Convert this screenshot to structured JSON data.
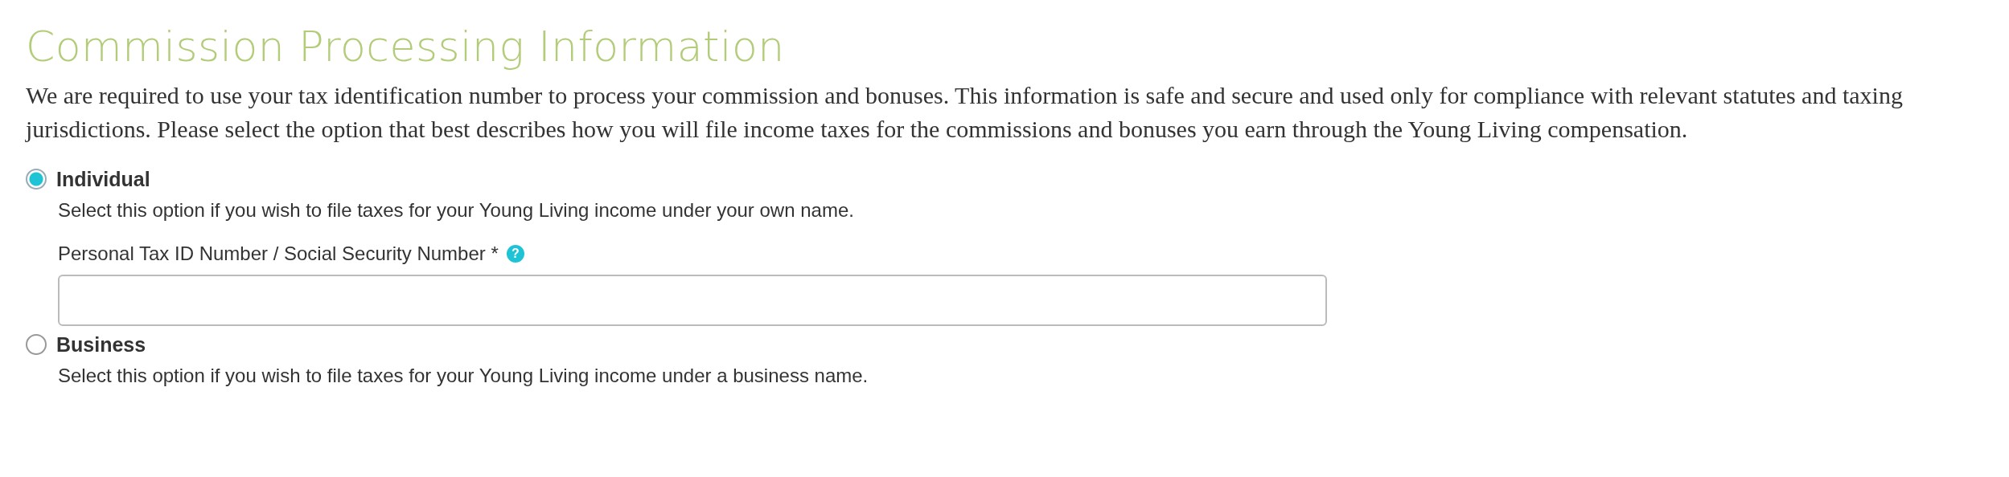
{
  "title": "Commission Processing Information",
  "intro": "We are required to use your tax identification number to process your commission and bonuses. This information is safe and secure and used only for compliance with relevant statutes and taxing jurisdictions. Please select the option that best describes how you will file income taxes for the commissions and bonuses you earn through the Young Living compensation.",
  "options": [
    {
      "label": "Individual",
      "selected": true,
      "description": "Select this option if you wish to file taxes for your Young Living income under your own name.",
      "field": {
        "label": "Personal Tax ID Number / Social Security Number *",
        "help": "?"
      }
    },
    {
      "label": "Business",
      "selected": false,
      "description": "Select this option if you wish to file taxes for your Young Living income under a business name."
    }
  ]
}
